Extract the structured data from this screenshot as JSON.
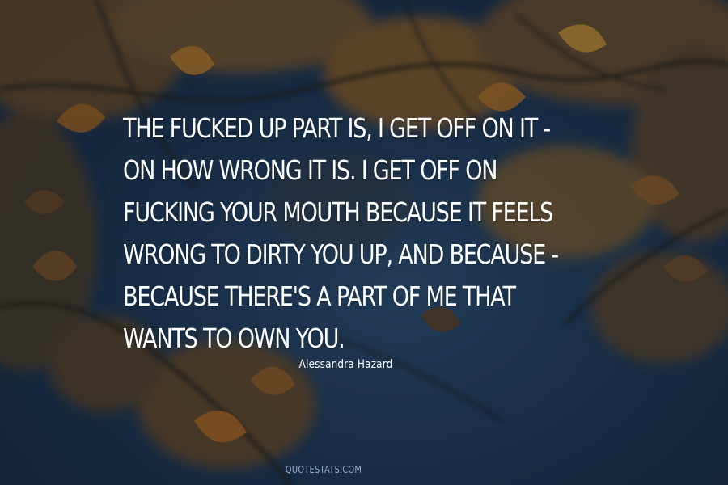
{
  "quote": {
    "lines": [
      "THE FUCKED UP PART IS, I GET OFF ON IT -",
      "ON HOW WRONG IT IS. I GET OFF ON",
      "FUCKING YOUR MOUTH BECAUSE IT FEELS",
      "WRONG TO DIRTY YOU UP, AND BECAUSE -",
      "BECAUSE THERE'S A PART OF ME THAT",
      "WANTS TO OWN YOU."
    ]
  },
  "author": "Alessandra Hazard",
  "watermark": "QUOTESTATS.COM",
  "colors": {
    "text": "#ffffff",
    "sky": "#1d3552",
    "leaf_orange": "#a8641f",
    "leaf_gold": "#c9922e",
    "watermark": "#aac3dc"
  }
}
